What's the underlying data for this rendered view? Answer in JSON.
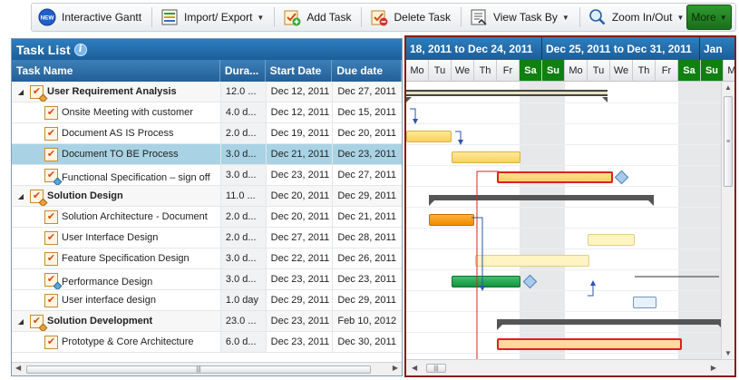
{
  "toolbar": {
    "buttons": [
      {
        "label": "Interactive Gantt",
        "icon": "new-badge-icon"
      },
      {
        "label": "Import/ Export",
        "icon": "import-export-icon",
        "dropdown": true
      },
      {
        "label": "Add Task",
        "icon": "add-task-icon"
      },
      {
        "label": "Delete Task",
        "icon": "delete-task-icon"
      },
      {
        "label": "View Task By",
        "icon": "view-task-icon",
        "dropdown": true
      },
      {
        "label": "Zoom In/Out",
        "icon": "zoom-icon",
        "dropdown": true
      }
    ],
    "more_label": "More",
    "new_badge": "NEW"
  },
  "tasklist": {
    "title": "Task List",
    "columns": {
      "name": "Task Name",
      "duration": "Dura...",
      "start": "Start Date",
      "due": "Due date"
    },
    "rows": [
      {
        "name": "User Requirement Analysis",
        "duration": "12.0 ...",
        "start": "Dec 12, 2011",
        "due": "Dec 27, 2011",
        "parent": true
      },
      {
        "name": "Onsite Meeting with customer",
        "duration": "4.0 d...",
        "start": "Dec 12, 2011",
        "due": "Dec 15, 2011"
      },
      {
        "name": "Document AS IS Process",
        "duration": "2.0 d...",
        "start": "Dec 19, 2011",
        "due": "Dec 20, 2011"
      },
      {
        "name": "Document TO BE Process",
        "duration": "3.0 d...",
        "start": "Dec 21, 2011",
        "due": "Dec 23, 2011",
        "selected": true
      },
      {
        "name": "Functional Specification – sign off",
        "duration": "3.0 d...",
        "start": "Dec 23, 2011",
        "due": "Dec 27, 2011",
        "milestone": true
      },
      {
        "name": "Solution Design",
        "duration": "11.0 ...",
        "start": "Dec 20, 2011",
        "due": "Dec 29, 2011",
        "parent": true
      },
      {
        "name": "Solution Architecture - Document",
        "duration": "2.0 d...",
        "start": "Dec 20, 2011",
        "due": "Dec 21, 2011"
      },
      {
        "name": "User Interface Design",
        "duration": "2.0 d...",
        "start": "Dec 27, 2011",
        "due": "Dec 28, 2011"
      },
      {
        "name": "Feature Specification Design",
        "duration": "3.0 d...",
        "start": "Dec 22, 2011",
        "due": "Dec 26, 2011"
      },
      {
        "name": "Performance Design",
        "duration": "3.0 d...",
        "start": "Dec 23, 2011",
        "due": "Dec 23, 2011",
        "milestone": true
      },
      {
        "name": "User interface design",
        "duration": "1.0 day",
        "start": "Dec 29, 2011",
        "due": "Dec 29, 2011"
      },
      {
        "name": "Solution Development",
        "duration": "23.0 ...",
        "start": "Dec 23, 2011",
        "due": "Feb 10, 2012",
        "parent": true
      },
      {
        "name": "Prototype & Core Architecture",
        "duration": "6.0 d...",
        "start": "Dec 23, 2011",
        "due": "Dec 30, 2011"
      }
    ]
  },
  "gantt": {
    "weeks": [
      "18, 2011 to Dec 24, 2011",
      "Dec 25, 2011 to Dec 31, 2011",
      "Jan"
    ],
    "days": [
      "Mo",
      "Tu",
      "We",
      "Th",
      "Fr",
      "Sa",
      "Su",
      "Mo",
      "Tu",
      "We",
      "Th",
      "Fr",
      "Sa",
      "Su",
      "Mo"
    ]
  },
  "colors": {
    "accent": "#1b5e99",
    "weekend": "#108010",
    "critical": "#e02020",
    "more_button": "#1b6f1b"
  }
}
